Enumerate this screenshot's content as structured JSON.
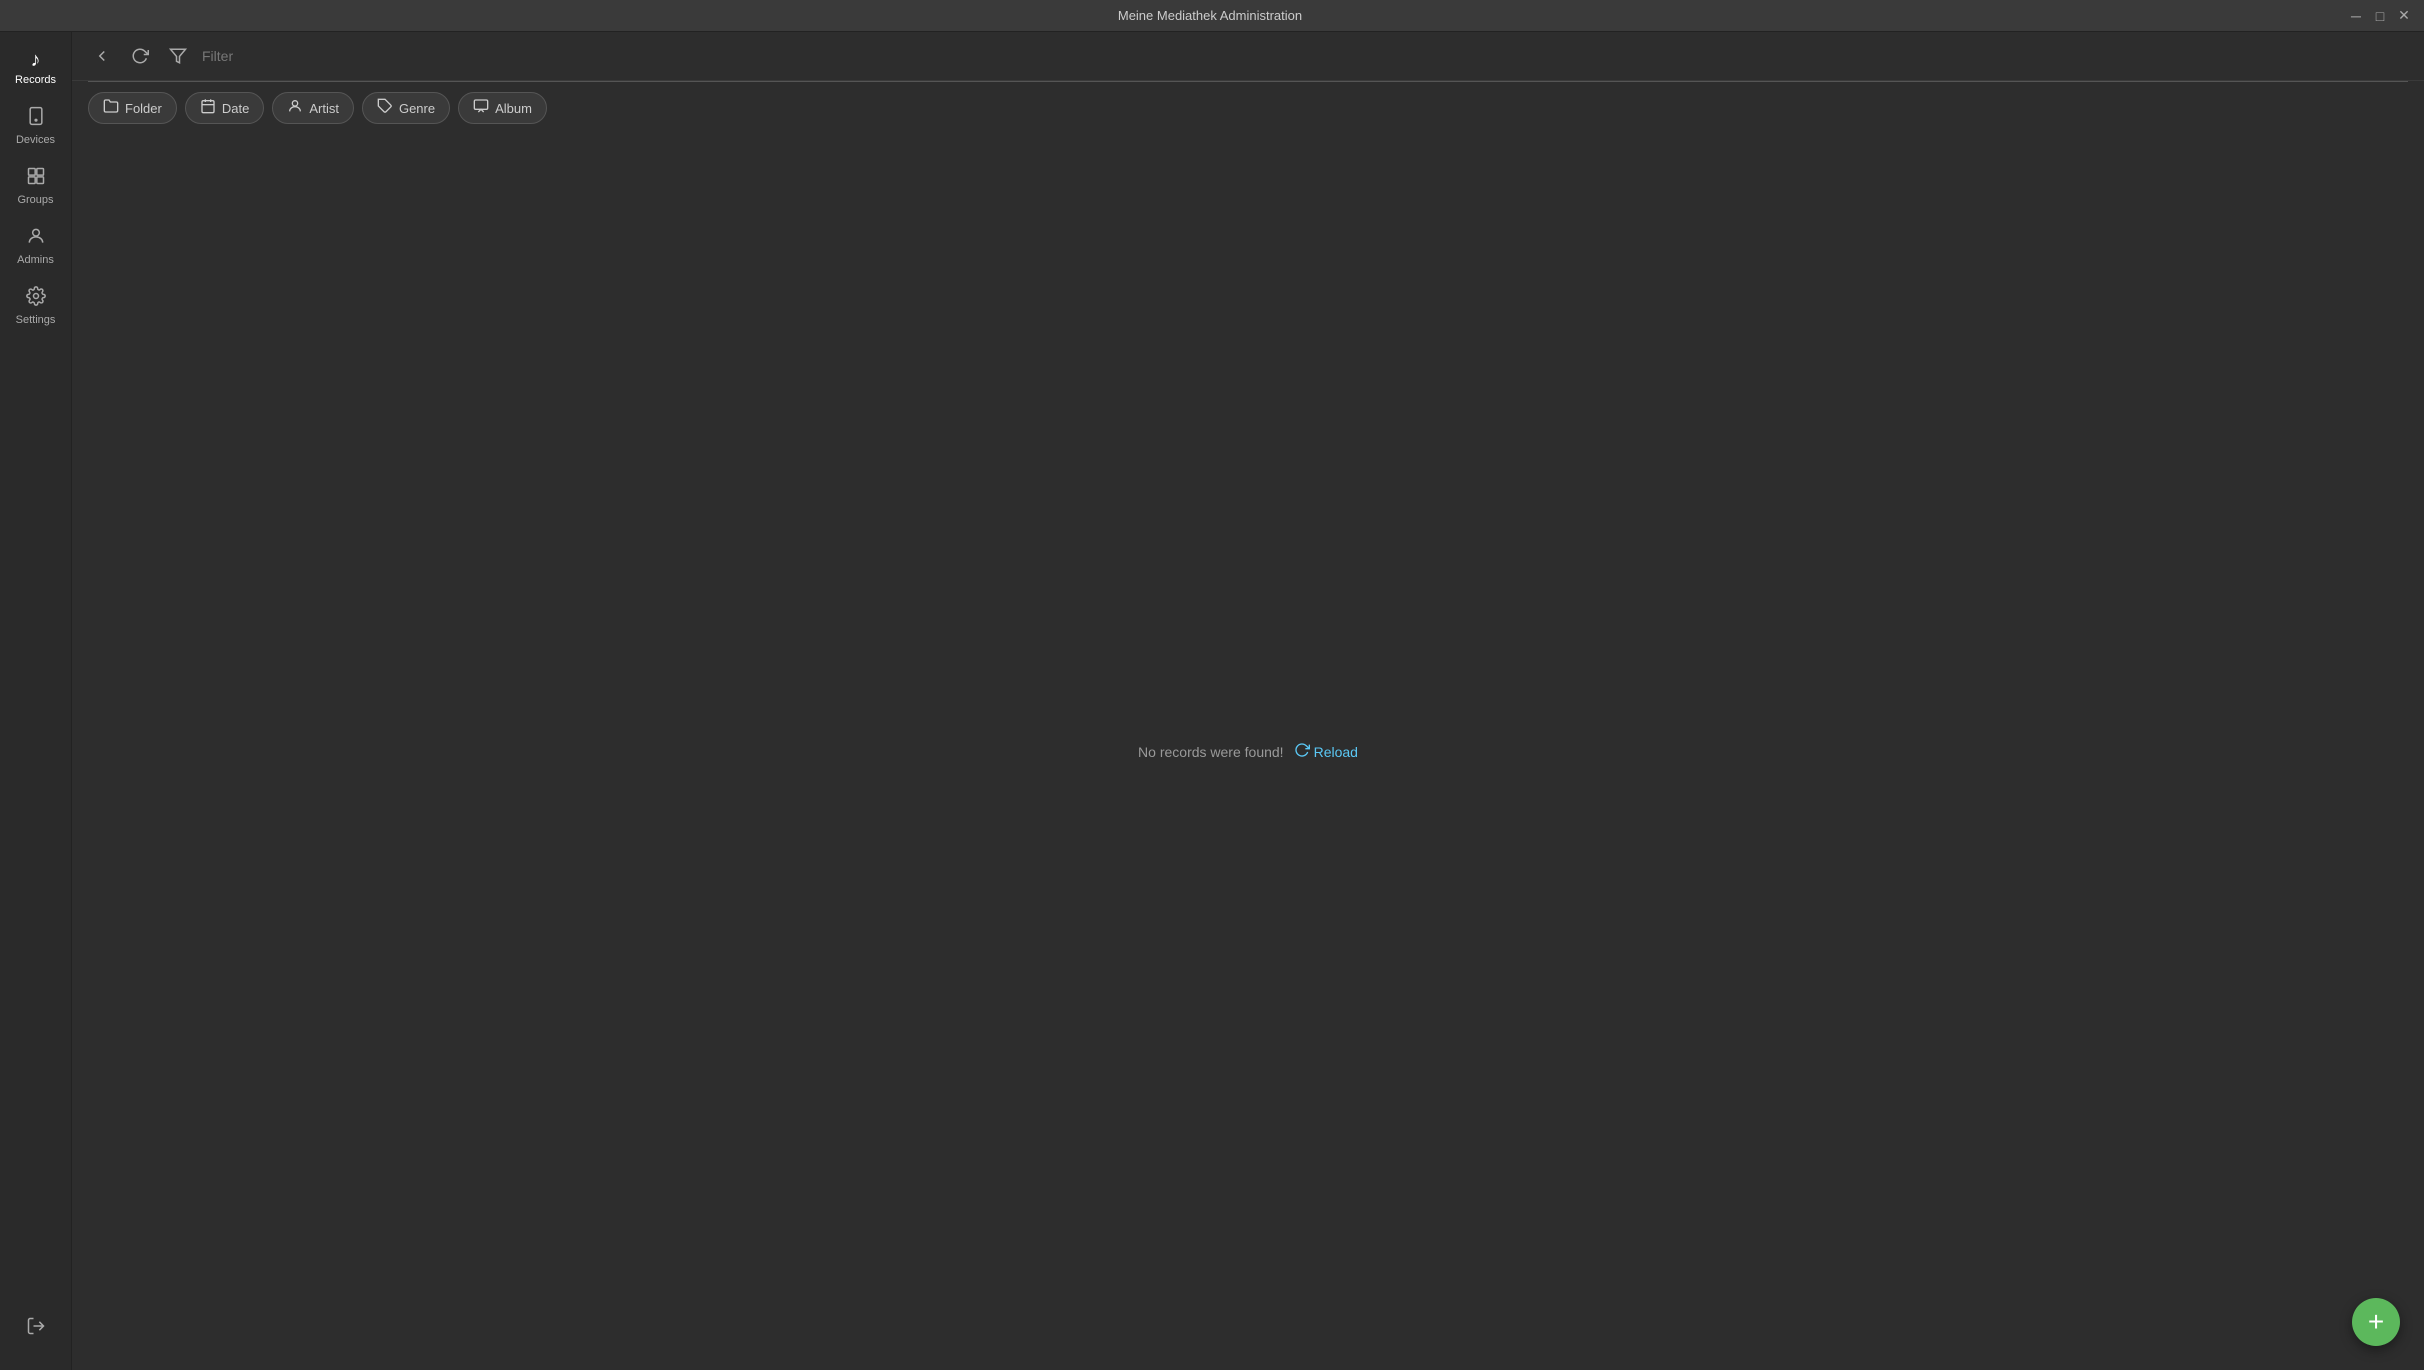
{
  "window": {
    "title": "Meine Mediathek Administration"
  },
  "titlebar": {
    "minimize_label": "─",
    "maximize_label": "□",
    "close_label": "✕"
  },
  "sidebar": {
    "items": [
      {
        "id": "records",
        "label": "Records",
        "icon": "♪",
        "active": true
      },
      {
        "id": "devices",
        "label": "Devices",
        "icon": "📱",
        "active": false
      },
      {
        "id": "groups",
        "label": "Groups",
        "icon": "⊞",
        "active": false
      },
      {
        "id": "admins",
        "label": "Admins",
        "icon": "👤",
        "active": false
      },
      {
        "id": "settings",
        "label": "Settings",
        "icon": "⚙",
        "active": false
      }
    ],
    "logout_label": "Logout",
    "logout_icon": "⇥"
  },
  "toolbar": {
    "back_icon": "←",
    "refresh_icon": "↻",
    "filter_icon": "▽",
    "filter_placeholder": "Filter"
  },
  "chips": [
    {
      "id": "folder",
      "label": "Folder",
      "icon": "📁"
    },
    {
      "id": "date",
      "label": "Date",
      "icon": "📅"
    },
    {
      "id": "artist",
      "label": "Artist",
      "icon": "👤"
    },
    {
      "id": "genre",
      "label": "Genre",
      "icon": "🏷"
    },
    {
      "id": "album",
      "label": "Album",
      "icon": "💿"
    }
  ],
  "empty_state": {
    "message": "No records were found!",
    "reload_label": "Reload",
    "reload_icon": "↻"
  },
  "fab": {
    "icon": "+",
    "color": "#5cb85c"
  }
}
